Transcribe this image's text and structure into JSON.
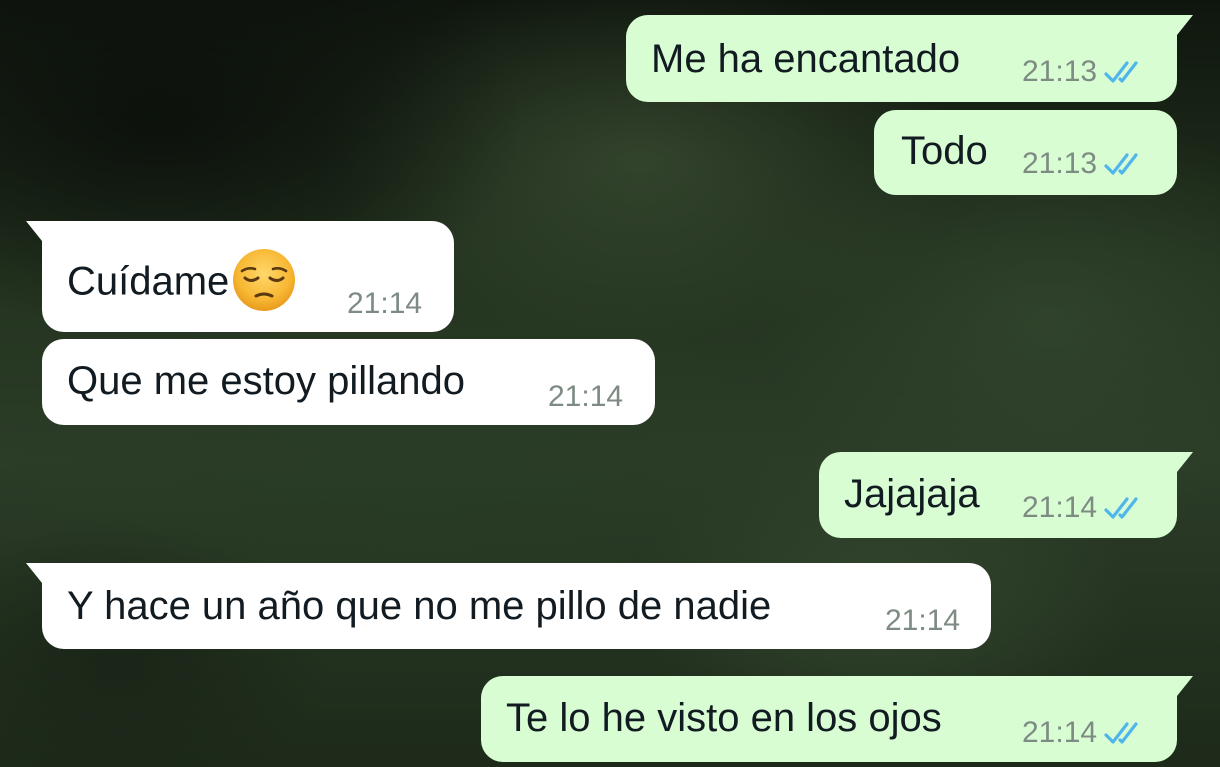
{
  "chat": {
    "messages": [
      {
        "direction": "outgoing",
        "text": "Me ha encantado",
        "time": "21:13",
        "status": "read"
      },
      {
        "direction": "outgoing",
        "text": "Todo",
        "time": "21:13",
        "status": "read"
      },
      {
        "direction": "incoming",
        "text": "Cuídame",
        "emoji": "pensive-face",
        "time": "21:14"
      },
      {
        "direction": "incoming",
        "text": "Que me estoy pillando",
        "time": "21:14"
      },
      {
        "direction": "outgoing",
        "text": "Jajajaja",
        "time": "21:14",
        "status": "read"
      },
      {
        "direction": "incoming",
        "text": "Y hace un año que no me pillo de nadie",
        "time": "21:14"
      },
      {
        "direction": "outgoing",
        "text": "Te lo he visto en los ojos",
        "time": "21:14",
        "status": "read"
      }
    ]
  },
  "colors": {
    "outgoing_bubble": "#d9fdd3",
    "incoming_bubble": "#ffffff",
    "read_tick": "#4fb6ec",
    "timestamp": "#7d8b83"
  },
  "icons": {
    "read_status": "double-check-icon",
    "emoji": "pensive-face-emoji"
  }
}
